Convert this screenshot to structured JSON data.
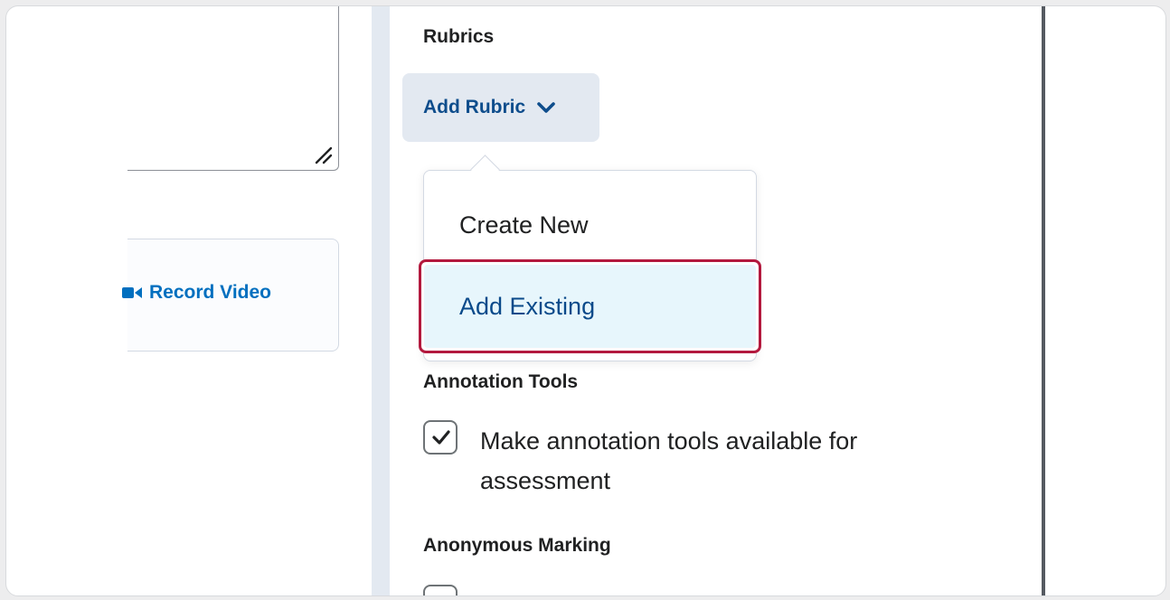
{
  "left": {
    "record_video_label": "Record Video"
  },
  "panel": {
    "rubrics_heading": "Rubrics",
    "add_rubric_label": "Add Rubric",
    "dropdown": {
      "create_new": "Create New",
      "add_existing": "Add Existing"
    },
    "annotation_heading": "Annotation Tools",
    "annotation_checkbox_label": "Make annotation tools available for assessment",
    "annotation_checked": true,
    "anonymous_heading": "Anonymous Marking"
  },
  "colors": {
    "link_blue": "#006fbf",
    "button_text": "#0e4d8c",
    "highlight_border": "#b3193e",
    "highlight_bg": "#e7f6fc",
    "panel_tint": "#e3e9f1"
  },
  "icons": [
    "resize-handle-icon",
    "video-camera-icon",
    "chevron-down-icon",
    "checkmark-icon"
  ]
}
